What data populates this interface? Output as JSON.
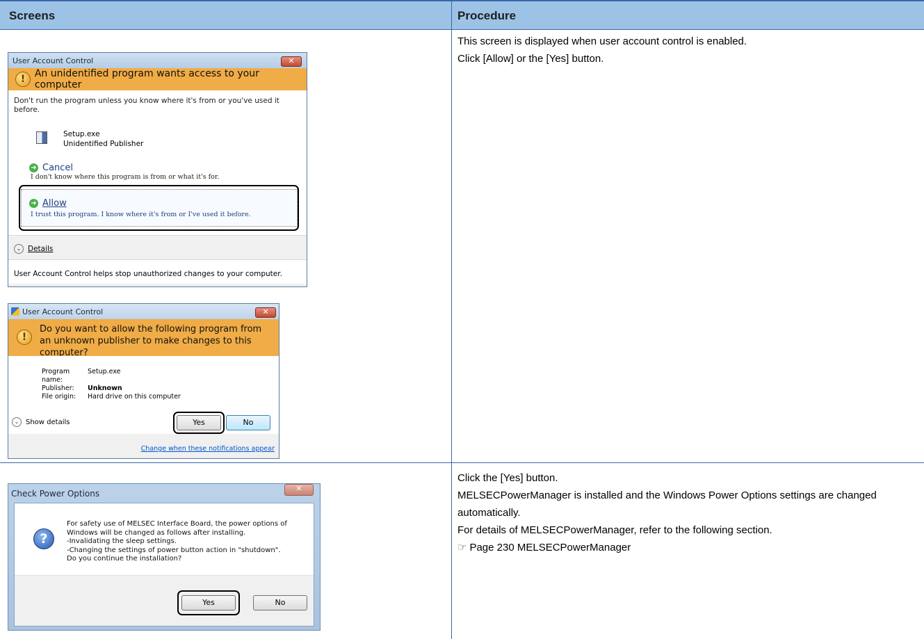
{
  "table": {
    "col1_header": "Screens",
    "col2_header": "Procedure"
  },
  "row1": {
    "procedure": [
      "This screen is displayed when user account control is enabled.",
      "Click [Allow] or the [Yes] button."
    ],
    "uac1": {
      "title": "User Account Control",
      "close": "✕",
      "banner": "An unidentified program wants access to your computer",
      "warning": "Don't run the program unless you know where it's from or you've used it before.",
      "program_name": "Setup.exe",
      "publisher": "Unidentified Publisher",
      "cancel_title": "Cancel",
      "cancel_desc": "I don't know where this program is from or what it's for.",
      "allow_title": "Allow",
      "allow_desc": "I trust this program. I know where it's from or I've used it before.",
      "details": "Details",
      "footer": "User Account Control helps stop unauthorized changes to your computer."
    },
    "uac2": {
      "title": "User Account Control",
      "close": "✕",
      "banner": "Do you want to allow the following program from an unknown publisher to make changes to this computer?",
      "fields": [
        {
          "label": "Program name:",
          "value": "Setup.exe"
        },
        {
          "label": "Publisher:",
          "value": "Unknown"
        },
        {
          "label": "File origin:",
          "value": "Hard drive on this computer"
        }
      ],
      "show_details": "Show details",
      "yes": "Yes",
      "no": "No",
      "link": "Change when these notifications appear"
    }
  },
  "row2": {
    "procedure": [
      "Click the [Yes] button.",
      "MELSECPowerManager is installed and the Windows Power Options settings are changed automatically.",
      "For details of MELSECPowerManager, refer to the following section."
    ],
    "reference": "Page 230 MELSECPowerManager",
    "dialog": {
      "title": "Check Power Options",
      "close": "✕",
      "message": [
        "For safety use of MELSEC Interface Board, the power options of",
        "Windows will be changed as follows after installing.",
        "-Invalidating the sleep settings.",
        "-Changing the settings of power button action in \"shutdown\".",
        "Do you continue the installation?"
      ],
      "yes": "Yes",
      "no": "No"
    }
  }
}
